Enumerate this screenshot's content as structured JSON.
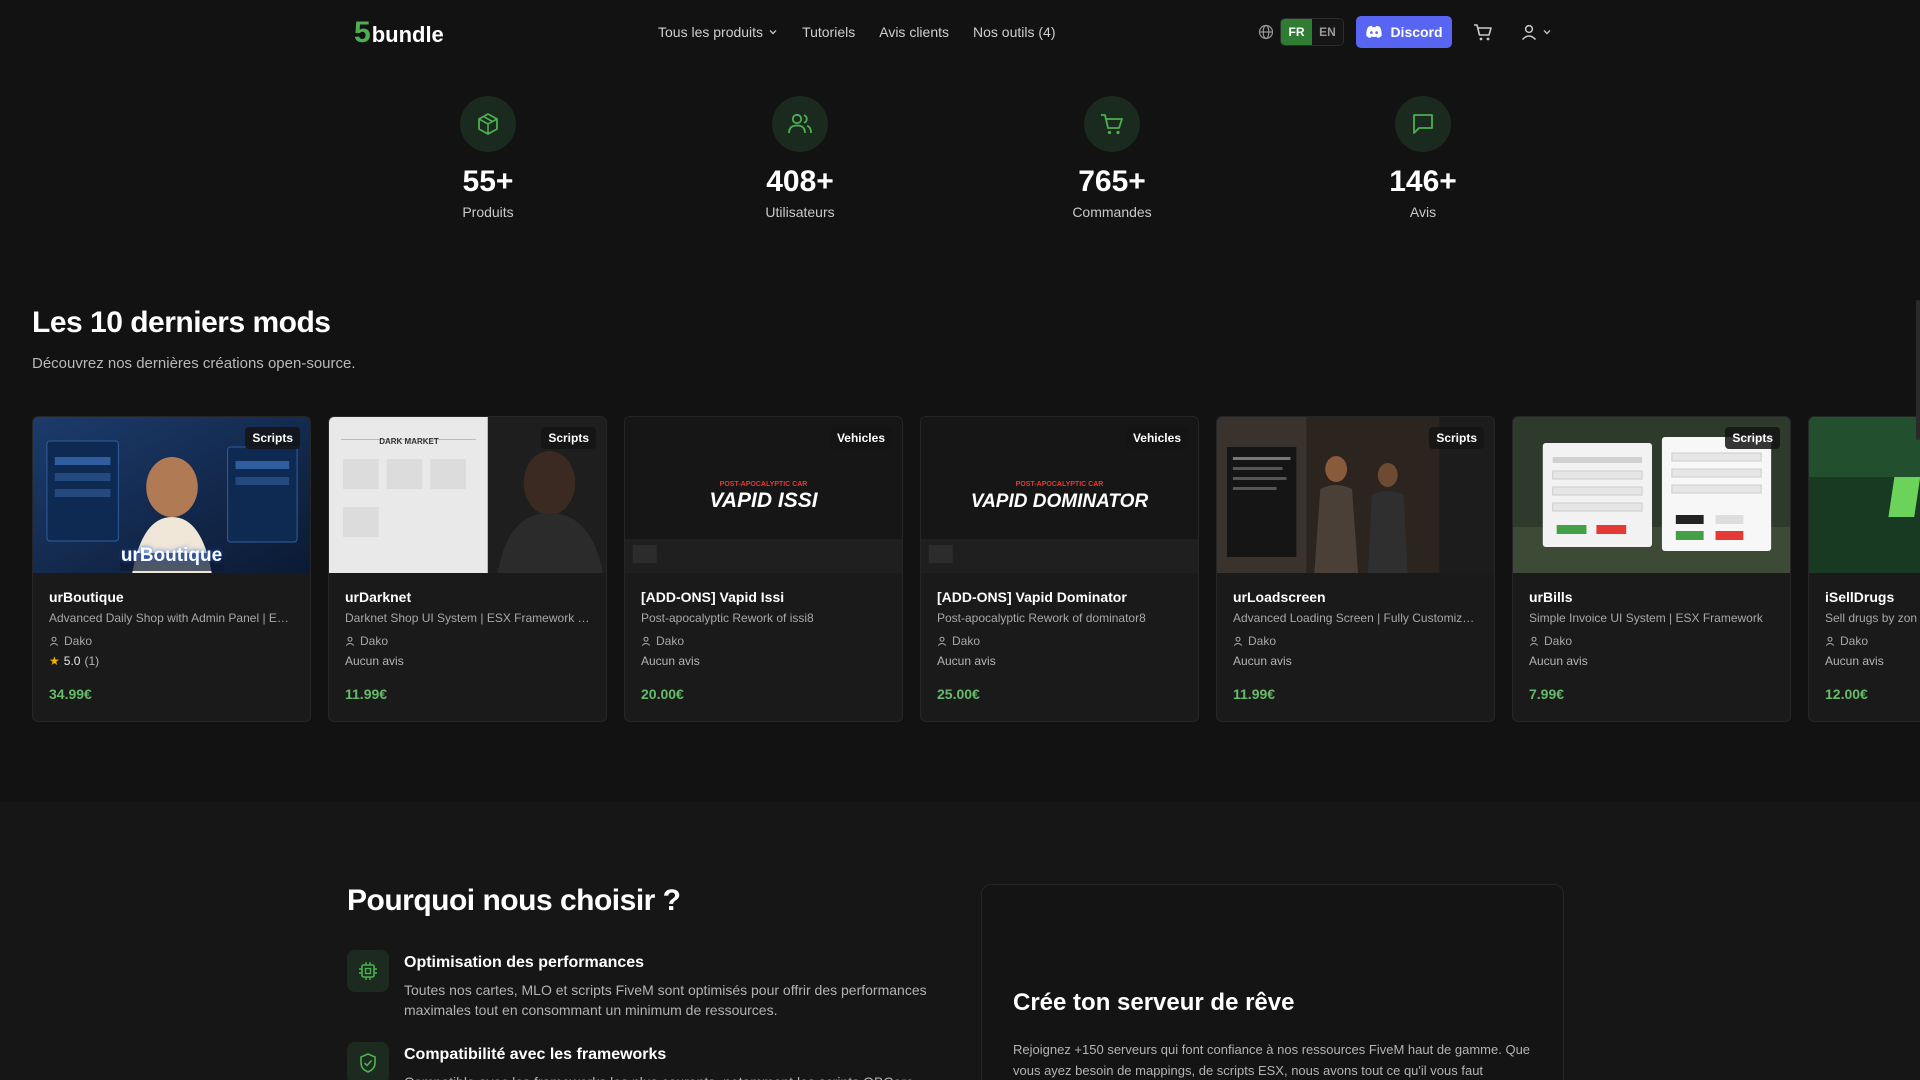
{
  "header": {
    "logo_digit": "5",
    "logo_word": "bundle",
    "nav": [
      "Tous les produits",
      "Tutoriels",
      "Avis clients",
      "Nos outils (4)"
    ],
    "lang_active": "FR",
    "lang_other": "EN",
    "discord_label": "Discord"
  },
  "stats": [
    {
      "value": "55+",
      "label": "Produits",
      "icon": "box-icon"
    },
    {
      "value": "408+",
      "label": "Utilisateurs",
      "icon": "users-icon"
    },
    {
      "value": "765+",
      "label": "Commandes",
      "icon": "cart-icon"
    },
    {
      "value": "146+",
      "label": "Avis",
      "icon": "message-icon"
    }
  ],
  "mods": {
    "title": "Les 10 derniers mods",
    "subtitle": "Découvrez nos dernières créations open-source.",
    "cards": [
      {
        "badge": "Scripts",
        "title": "urBoutique",
        "desc": "Advanced Daily Shop with Admin Panel | ESX...",
        "author": "Dako",
        "rating": "5.0",
        "rating_count": "(1)",
        "price": "34.99€",
        "thumb_text": "urBoutique"
      },
      {
        "badge": "Scripts",
        "title": "urDarknet",
        "desc": "Darknet Shop UI System | ESX Framework &...",
        "author": "Dako",
        "reviews": "Aucun avis",
        "price": "11.99€",
        "thumb_text": "DARK MARKET"
      },
      {
        "badge": "Vehicles",
        "title": "[ADD-ONS] Vapid Issi",
        "desc": "Post-apocalyptic Rework of issi8",
        "author": "Dako",
        "reviews": "Aucun avis",
        "price": "20.00€",
        "thumb_kicker": "POST-APOCALYPTIC CAR",
        "thumb_text": "VAPID ISSI"
      },
      {
        "badge": "Vehicles",
        "title": "[ADD-ONS] Vapid Dominator",
        "desc": "Post-apocalyptic Rework of dominator8",
        "author": "Dako",
        "reviews": "Aucun avis",
        "price": "25.00€",
        "thumb_kicker": "POST-APOCALYPTIC CAR",
        "thumb_text": "VAPID DOMINATOR"
      },
      {
        "badge": "Scripts",
        "title": "urLoadscreen",
        "desc": "Advanced Loading Screen | Fully Customizable",
        "author": "Dako",
        "reviews": "Aucun avis",
        "price": "11.99€"
      },
      {
        "badge": "Scripts",
        "title": "urBills",
        "desc": "Simple Invoice UI System | ESX Framework",
        "author": "Dako",
        "reviews": "Aucun avis",
        "price": "7.99€"
      },
      {
        "title": "iSellDrugs",
        "desc": "Sell drugs by zon",
        "author": "Dako",
        "reviews": "Aucun avis",
        "price": "12.00€"
      }
    ]
  },
  "why": {
    "title": "Pourquoi nous choisir ?",
    "features": [
      {
        "title": "Optimisation des performances",
        "desc": "Toutes nos cartes, MLO et scripts FiveM sont optimisés pour offrir des performances maximales tout en consommant un minimum de ressources."
      },
      {
        "title": "Compatibilité avec les frameworks",
        "desc": "Compatible avec les frameworks les plus courants, notamment les scripts QBCore, les"
      }
    ],
    "dream_title": "Crée ton serveur de rêve",
    "dream_text": "Rejoignez +150 serveurs qui font confiance à nos ressources FiveM haut de gamme. Que vous ayez besoin de mappings, de scripts ESX, nous avons tout ce qu'il vous faut"
  },
  "colors": {
    "accent": "#4caf50",
    "discord": "#5865f2",
    "price": "#66bb6a",
    "bg": "#121212"
  }
}
